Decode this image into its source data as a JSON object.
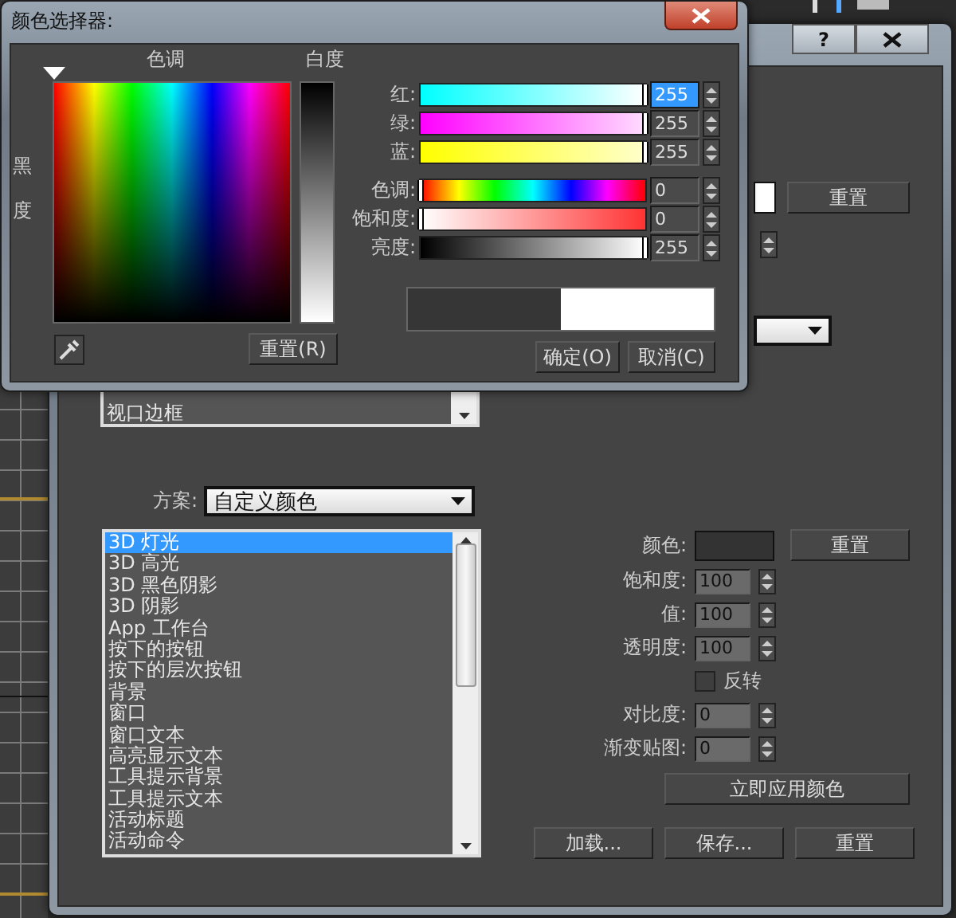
{
  "picker": {
    "title": "颜色选择器:",
    "hue_label": "色调",
    "whiteness_label": "白度",
    "blackness_label": "黑度",
    "reset_button": "重置(R)",
    "channels": [
      {
        "kind": "red",
        "label": "红:",
        "value": "255",
        "level": 1,
        "focused": true
      },
      {
        "kind": "green",
        "label": "绿:",
        "value": "255",
        "level": 1,
        "focused": false
      },
      {
        "kind": "blue",
        "label": "蓝:",
        "value": "255",
        "level": 1,
        "focused": false
      },
      {
        "kind": "hue",
        "label": "色调:",
        "value": "0",
        "level": 0,
        "focused": false
      },
      {
        "kind": "saturation",
        "label": "饱和度:",
        "value": "0",
        "level": 0,
        "focused": false
      },
      {
        "kind": "value",
        "label": "亮度:",
        "value": "255",
        "level": 1,
        "focused": false
      }
    ],
    "preview": [
      {
        "color": "#363636"
      },
      {
        "color": "#ffffff"
      }
    ],
    "buttons": [
      "确定(O)",
      "取消(C)"
    ]
  },
  "dialog": {
    "help_button": "?",
    "top_swatch": {
      "color": "#ffffff"
    },
    "top_reset_button": "重置",
    "top_list": [
      "视口边框"
    ],
    "scheme_label": "方案:",
    "scheme_value": "自定义颜色",
    "elements": [
      {
        "label": "3D 灯光",
        "selected": true
      },
      {
        "label": "3D 高光",
        "selected": false
      },
      {
        "label": "3D 黑色阴影",
        "selected": false
      },
      {
        "label": "3D 阴影",
        "selected": false
      },
      {
        "label": "App 工作台",
        "selected": false
      },
      {
        "label": "按下的按钮",
        "selected": false
      },
      {
        "label": "按下的层次按钮",
        "selected": false
      },
      {
        "label": "背景",
        "selected": false
      },
      {
        "label": "窗口",
        "selected": false
      },
      {
        "label": "窗口文本",
        "selected": false
      },
      {
        "label": "高亮显示文本",
        "selected": false
      },
      {
        "label": "工具提示背景",
        "selected": false
      },
      {
        "label": "工具提示文本",
        "selected": false
      },
      {
        "label": "活动标题",
        "selected": false
      },
      {
        "label": "活动命令",
        "selected": false
      }
    ],
    "color_label": "颜色:",
    "color_swatch": {
      "color": "#333333"
    },
    "color_reset_button": "重置",
    "fields": [
      {
        "label": "饱和度:",
        "value": "100"
      },
      {
        "label": "值:",
        "value": "100"
      },
      {
        "label": "透明度:",
        "value": "100"
      }
    ],
    "invert": {
      "label": "反转",
      "checked": false
    },
    "fields2": [
      {
        "label": "对比度:",
        "value": "0"
      },
      {
        "label": "渐变贴图:",
        "value": "0"
      }
    ],
    "apply_button": "立即应用颜色",
    "buttons": [
      "加载...",
      "保存...",
      "重置"
    ]
  }
}
